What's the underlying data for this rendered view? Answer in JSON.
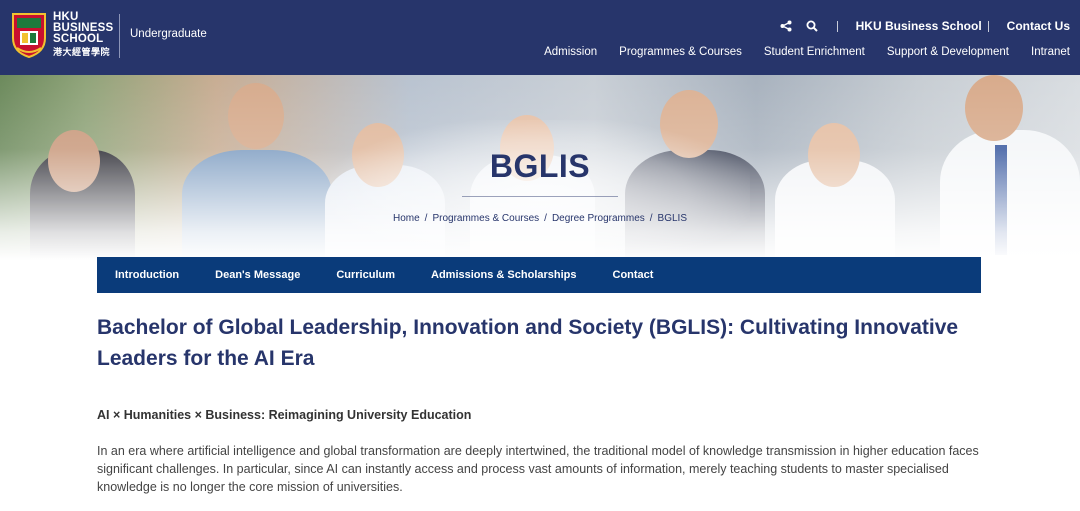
{
  "header": {
    "brand_line1": "HKU",
    "brand_line2": "BUSINESS",
    "brand_line3": "SCHOOL",
    "brand_chinese": "港大經管學院",
    "subtitle": "Undergraduate",
    "utility": {
      "share_icon": "share-icon",
      "search_icon": "search-icon",
      "school_link": "HKU Business School",
      "contact_link": "Contact Us"
    },
    "nav": [
      "Admission",
      "Programmes & Courses",
      "Student Enrichment",
      "Support & Development",
      "Intranet"
    ],
    "bg_color": "#27356b"
  },
  "hero": {
    "title": "BGLIS",
    "breadcrumb": [
      "Home",
      "Programmes & Courses",
      "Degree Programmes",
      "BGLIS"
    ],
    "breadcrumb_separator": "/"
  },
  "tabs": [
    "Introduction",
    "Dean's Message",
    "Curriculum",
    "Admissions & Scholarships",
    "Contact"
  ],
  "tab_bar_color": "#0a3b7a",
  "content": {
    "title": "Bachelor of Global Leadership, Innovation and Society (BGLIS): Cultivating Innovative Leaders for the AI Era",
    "subheading": "AI × Humanities × Business: Reimagining University Education",
    "paragraph": "In an era where artificial intelligence and global transformation are deeply intertwined, the traditional model of knowledge transmission in higher education faces significant challenges. In particular, since AI can instantly access and process vast amounts of information, merely teaching students to master specialised knowledge is no longer the core mission of universities."
  }
}
